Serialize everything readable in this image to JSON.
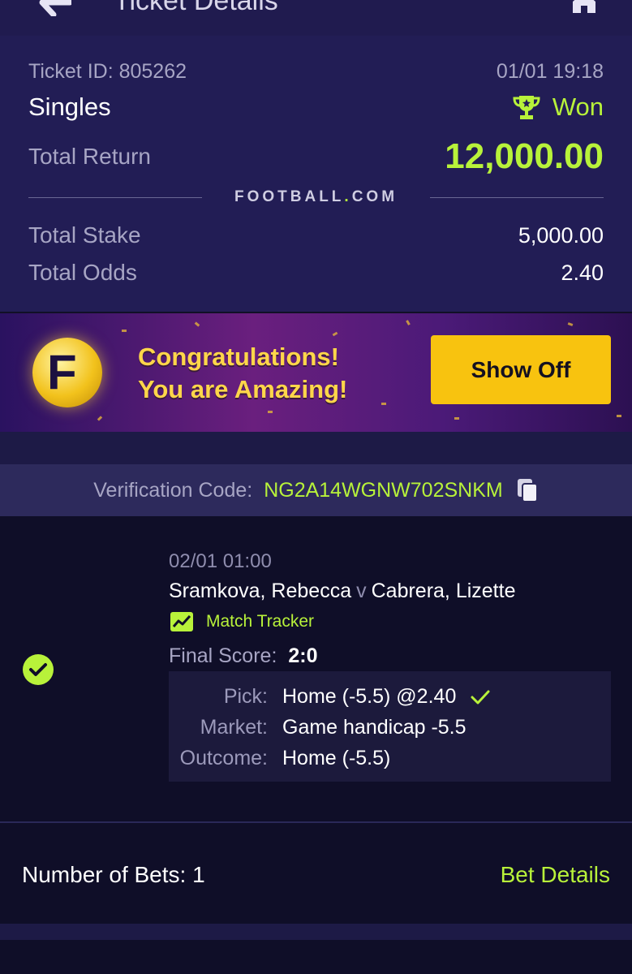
{
  "header": {
    "title": "Ticket Details"
  },
  "ticket": {
    "id_label": "Ticket ID: 805262",
    "datetime": "01/01 19:18",
    "type": "Singles",
    "status": "Won",
    "total_return_label": "Total Return",
    "total_return": "12,000.00",
    "brand": {
      "name": "FOOTBALL",
      "dot": ".",
      "suffix": "COM"
    },
    "total_stake_label": "Total Stake",
    "total_stake": "5,000.00",
    "total_odds_label": "Total Odds",
    "total_odds": "2.40"
  },
  "banner": {
    "line1": "Congratulations!",
    "line2": "You are Amazing!",
    "button": "Show Off"
  },
  "verification": {
    "label": "Verification Code:",
    "code": "NG2A14WGNW702SNKM"
  },
  "bet": {
    "date": "02/01 01:00",
    "home": "Sramkova, Rebecca",
    "v": "v",
    "away": "Cabrera, Lizette",
    "tracker": "Match Tracker",
    "final_label": "Final Score:",
    "final_score": "2:0",
    "pick_label": "Pick:",
    "pick": "Home (-5.5) @2.40",
    "market_label": "Market:",
    "market": "Game handicap -5.5",
    "outcome_label": "Outcome:",
    "outcome": "Home (-5.5)"
  },
  "footer": {
    "bets_count": "Number of Bets: 1",
    "bet_details": "Bet Details"
  },
  "colors": {
    "accent": "#b8f23a",
    "button": "#f8c30f",
    "panel": "#221d55"
  }
}
